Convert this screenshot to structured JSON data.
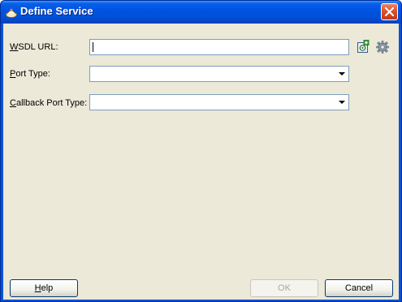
{
  "window": {
    "title": "Define Service"
  },
  "form": {
    "wsdl_url": {
      "label_mnemonic": "W",
      "label_rest": "SDL URL:",
      "value": ""
    },
    "port_type": {
      "label_mnemonic": "P",
      "label_rest": "ort Type:",
      "selected": ""
    },
    "callback_port_type": {
      "label_mnemonic": "C",
      "label_rest": "allback Port Type:",
      "selected": ""
    }
  },
  "icons": {
    "browse": "wsdl-browse-icon",
    "find_service": "find-service-gear-icon"
  },
  "buttons": {
    "help_mnemonic": "H",
    "help_rest": "elp",
    "ok": "OK",
    "cancel": "Cancel"
  },
  "colors": {
    "titlebar": "#0054e3",
    "dialog_background": "#ece9d8",
    "close_button": "#d9532d",
    "field_border": "#7f9db9"
  }
}
